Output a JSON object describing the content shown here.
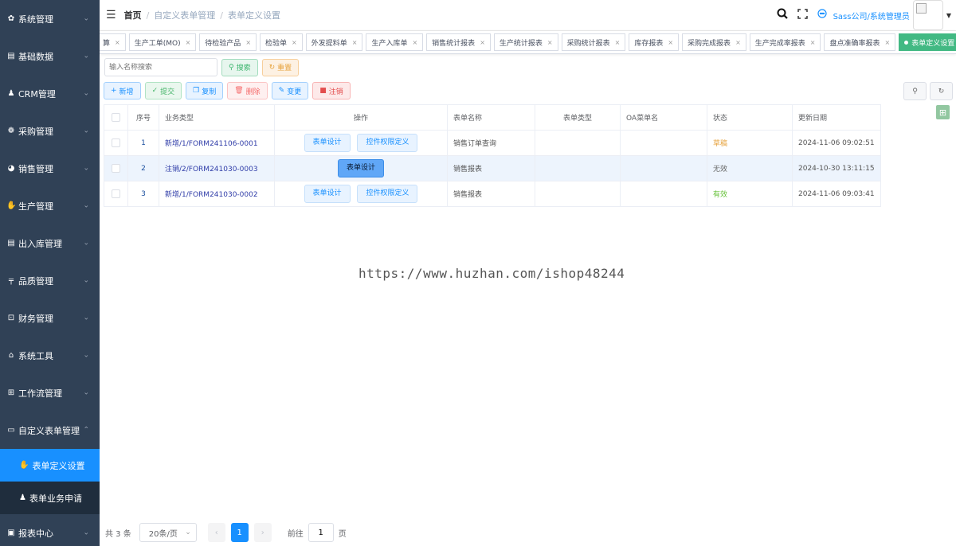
{
  "sidebar": {
    "items": [
      {
        "label": "系统管理",
        "icon": "gear-icon",
        "glyph": "✿"
      },
      {
        "label": "基础数据",
        "icon": "list-icon",
        "glyph": "▤"
      },
      {
        "label": "CRM管理",
        "icon": "user-icon",
        "glyph": "♟"
      },
      {
        "label": "采购管理",
        "icon": "globe-icon",
        "glyph": "❁"
      },
      {
        "label": "销售管理",
        "icon": "compass-icon",
        "glyph": "◕"
      },
      {
        "label": "生产管理",
        "icon": "hand-icon",
        "glyph": "✋"
      },
      {
        "label": "出入库管理",
        "icon": "list-icon",
        "glyph": "▤"
      },
      {
        "label": "品质管理",
        "icon": "chart-icon",
        "glyph": "╤"
      },
      {
        "label": "财务管理",
        "icon": "finance-icon",
        "glyph": "⊡"
      },
      {
        "label": "系统工具",
        "icon": "toolbox-icon",
        "glyph": "⌂"
      },
      {
        "label": "工作流管理",
        "icon": "workflow-icon",
        "glyph": "⊞"
      },
      {
        "label": "自定义表单管理",
        "icon": "form-icon",
        "glyph": "▭"
      }
    ],
    "sub_items": [
      {
        "label": "表单定义设置",
        "icon": "hand-icon",
        "glyph": "✋"
      },
      {
        "label": "表单业务申请",
        "icon": "user-icon",
        "glyph": "♟"
      }
    ],
    "last_item": {
      "label": "报表中心",
      "icon": "monitor-icon",
      "glyph": "▣"
    }
  },
  "header": {
    "breadcrumb": [
      "首页",
      "自定义表单管理",
      "表单定义设置"
    ],
    "user": "Sass公司/系统管理员"
  },
  "tags": [
    {
      "label": "算"
    },
    {
      "label": "生产工单(MO)"
    },
    {
      "label": "待检验产品"
    },
    {
      "label": "检验单"
    },
    {
      "label": "外发提料单"
    },
    {
      "label": "生产入库单"
    },
    {
      "label": "销售统计报表"
    },
    {
      "label": "生产统计报表"
    },
    {
      "label": "采购统计报表"
    },
    {
      "label": "库存报表"
    },
    {
      "label": "采购完成报表"
    },
    {
      "label": "生产完成率报表"
    },
    {
      "label": "盘点准确率报表"
    },
    {
      "label": "表单定义设置"
    }
  ],
  "search": {
    "placeholder": "输入名称搜索",
    "search_label": "搜索",
    "reset_label": "重置"
  },
  "toolbar": {
    "add": "新增",
    "submit": "提交",
    "copy": "复制",
    "delete": "删除",
    "change": "变更",
    "cancel": "注销"
  },
  "table": {
    "headers": [
      "序号",
      "业务类型",
      "操作",
      "表单名称",
      "表单类型",
      "OA菜单名",
      "状态",
      "更新日期"
    ],
    "rows": [
      {
        "index": "1",
        "biz": "新增/1/FORM241106-0001",
        "op1": "表单设计",
        "op2": "控件权限定义",
        "name": "销售订单查询",
        "type": "",
        "oa": "",
        "status": "草稿",
        "date": "2024-11-06 09:02:51"
      },
      {
        "index": "2",
        "biz": "注销/2/FORM241030-0003",
        "op1": "表单设计",
        "op2": "",
        "name": "销售报表",
        "type": "",
        "oa": "",
        "status": "无效",
        "date": "2024-10-30 13:11:15"
      },
      {
        "index": "3",
        "biz": "新增/1/FORM241030-0002",
        "op1": "表单设计",
        "op2": "控件权限定义",
        "name": "销售报表",
        "type": "",
        "oa": "",
        "status": "有效",
        "date": "2024-11-06 09:03:41"
      }
    ]
  },
  "watermark": "https://www.huzhan.com/ishop48244",
  "pager": {
    "total": "共 3 条",
    "size": "20条/页",
    "current": "1",
    "goto_label": "前往",
    "goto_value": "1",
    "page_unit": "页"
  },
  "colors": {
    "sidebar": "#304156",
    "active": "#1890ff",
    "tag_active": "#42b983"
  }
}
